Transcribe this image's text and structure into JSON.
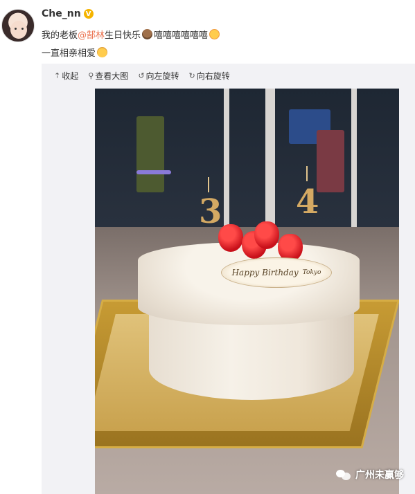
{
  "post": {
    "username": "Che_nn",
    "verified_badge": "V",
    "line1_prefix": "我的老板",
    "mention": "@郜林",
    "line1_mid": " 生日快乐",
    "line1_laugh": "嘻嘻嘻嘻嘻嘻",
    "line2": "一直相亲相爱"
  },
  "toolbar": {
    "collapse": "收起",
    "view_large": "查看大图",
    "rotate_left": "向左旋转",
    "rotate_right": "向右旋转"
  },
  "photo": {
    "candle_left": "3",
    "candle_right": "4",
    "plaque_text": "Happy Birthday",
    "plaque_brand": "Tokyo"
  },
  "watermark": {
    "text": "广州未赢够"
  },
  "colors": {
    "mention": "#eb7350",
    "badge": "#f5b400"
  },
  "icons": [
    "collapse-icon",
    "magnifier-icon",
    "rotate-left-icon",
    "rotate-right-icon",
    "wechat-icon"
  ]
}
